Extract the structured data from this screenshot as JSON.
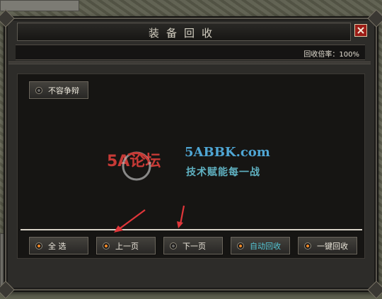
{
  "window": {
    "title": "装备回收",
    "close_label": "close"
  },
  "rate": {
    "text": "回收倍率：100%"
  },
  "options": {
    "no_contest_label": "不容争辩"
  },
  "buttons": {
    "select_all": "全 选",
    "prev_page": "上一页",
    "next_page": "下一页",
    "auto_recycle": "自动回收",
    "one_click_recycle": "一键回收"
  },
  "watermark": {
    "logo_text": "5A论坛",
    "site": "5ABBK.com",
    "slogan": "技术赋能每一战"
  },
  "colors": {
    "accent_orange": "#ff8c26",
    "cyan_text": "#55c9d8",
    "close_red": "#9b1c16",
    "annotation_arrow": "#e0363a"
  },
  "icons": [
    "close-icon",
    "radio-indicator-icon",
    "arrow-annotation-icon"
  ]
}
